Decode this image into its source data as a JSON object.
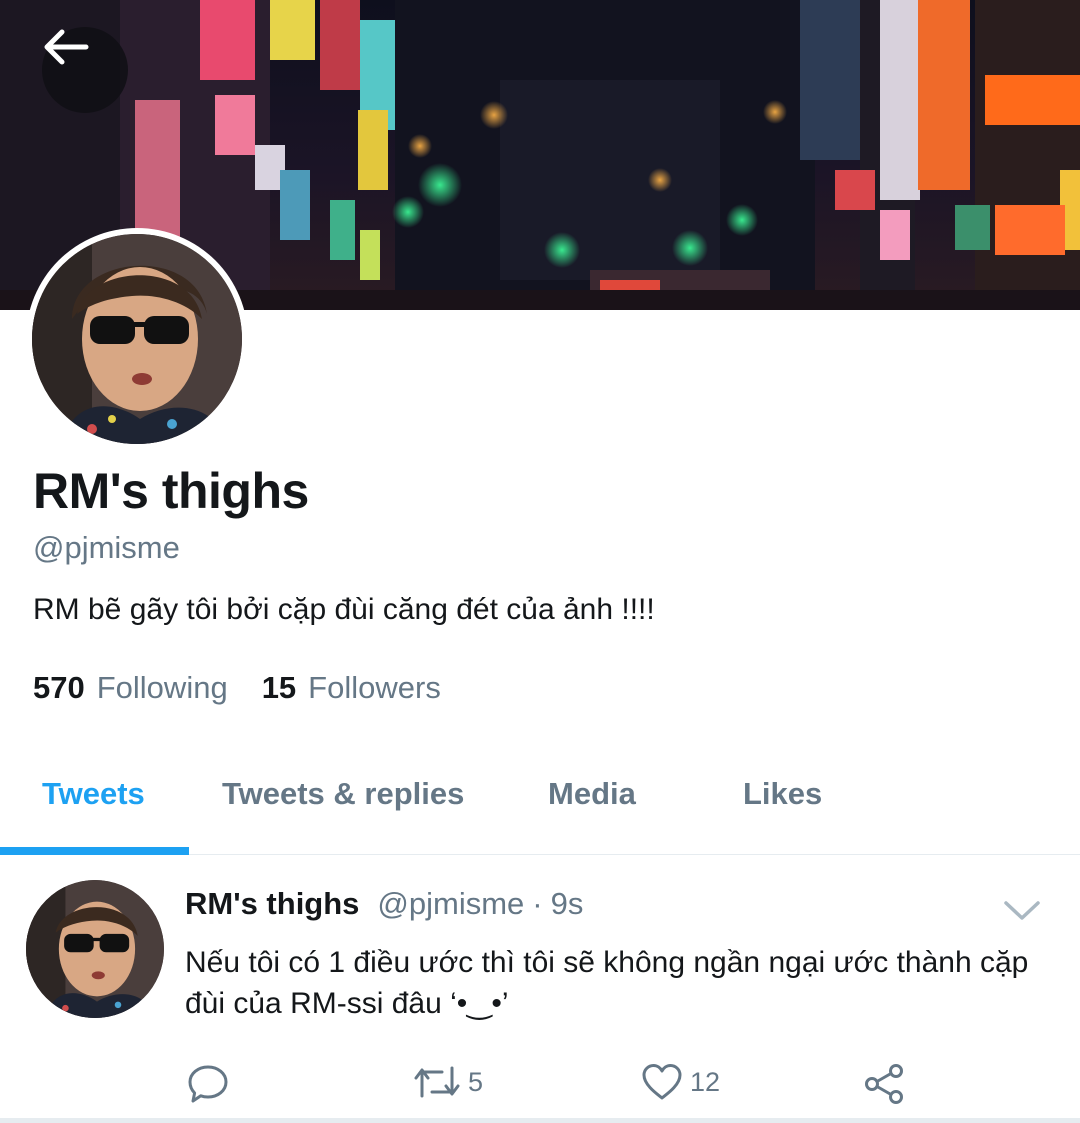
{
  "profile": {
    "display_name": "RM's thighs",
    "handle": "@pjmisme",
    "bio": "RM bẽ gãy tôi bởi cặp đùi căng đét của ảnh !!!!",
    "following_count": "570",
    "following_label": "Following",
    "followers_count": "15",
    "followers_label": "Followers"
  },
  "tabs": [
    {
      "label": "Tweets",
      "active": true
    },
    {
      "label": "Tweets & replies",
      "active": false
    },
    {
      "label": "Media",
      "active": false
    },
    {
      "label": "Likes",
      "active": false
    }
  ],
  "tweet": {
    "name": "RM's thighs",
    "handle": "@pjmisme",
    "separator": "·",
    "time": "9s",
    "text": "Nếu tôi có 1 điều ước thì tôi sẽ không ngần ngại ước thành cặp đùi của RM-ssi đâu ‘•‿•’",
    "retweet_count": "5",
    "like_count": "12"
  },
  "icons": {
    "back": "back-arrow-icon",
    "caret": "chevron-down-icon",
    "reply": "reply-icon",
    "retweet": "retweet-icon",
    "like": "heart-icon",
    "share": "share-icon"
  },
  "colors": {
    "accent": "#1da1f2",
    "secondary_text": "#657786",
    "primary_text": "#14171a",
    "divider": "#e6ecf0"
  }
}
